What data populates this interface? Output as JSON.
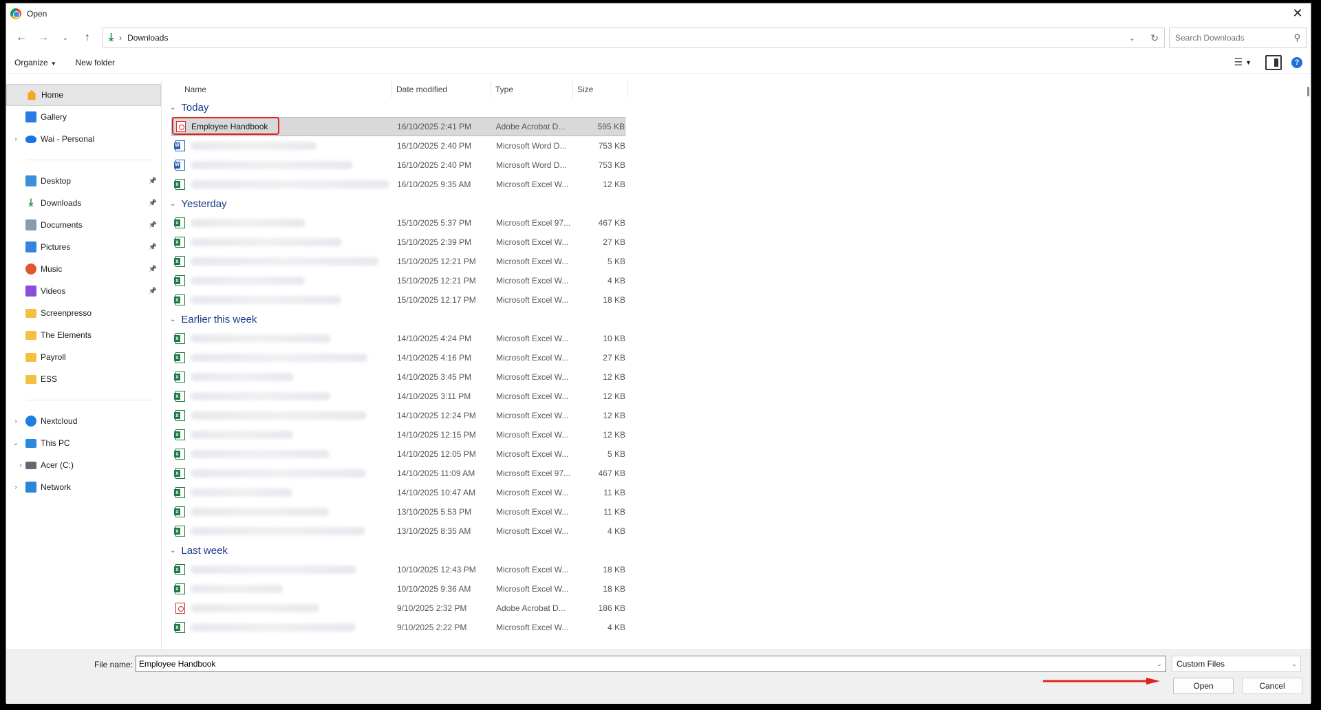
{
  "window": {
    "title": "Open"
  },
  "address": {
    "crumb": "Downloads"
  },
  "search": {
    "placeholder": "Search Downloads"
  },
  "toolbar": {
    "organize": "Organize",
    "new_folder": "New folder"
  },
  "sidebar": {
    "group1": [
      {
        "label": "Home",
        "icon": "home-icon",
        "selected": true,
        "chevron": false
      },
      {
        "label": "Gallery",
        "icon": "gallery-icon",
        "chevron": false
      },
      {
        "label": "Wai - Personal",
        "icon": "onedrive-icon",
        "chevron": true
      }
    ],
    "group2": [
      {
        "label": "Desktop",
        "icon": "desktop-icon",
        "pinned": true
      },
      {
        "label": "Downloads",
        "icon": "downloads-icon",
        "pinned": true
      },
      {
        "label": "Documents",
        "icon": "documents-icon",
        "pinned": true
      },
      {
        "label": "Pictures",
        "icon": "pictures-icon",
        "pinned": true
      },
      {
        "label": "Music",
        "icon": "music-icon",
        "pinned": true
      },
      {
        "label": "Videos",
        "icon": "videos-icon",
        "pinned": true
      },
      {
        "label": "Screenpresso",
        "icon": "folder-icon"
      },
      {
        "label": "The Elements",
        "icon": "folder-icon"
      },
      {
        "label": "Payroll",
        "icon": "folder-icon"
      },
      {
        "label": "ESS",
        "icon": "folder-icon"
      }
    ],
    "group3": [
      {
        "label": "Nextcloud",
        "icon": "nextcloud-icon",
        "chevron": "right"
      },
      {
        "label": "This PC",
        "icon": "pc-icon",
        "chevron": "down"
      },
      {
        "label": "Acer (C:)",
        "icon": "drive-icon",
        "chevron": "right",
        "indent": true
      },
      {
        "label": "Network",
        "icon": "network-icon",
        "chevron": "right"
      }
    ]
  },
  "columns": {
    "name": "Name",
    "date": "Date modified",
    "type": "Type",
    "size": "Size"
  },
  "groups": [
    {
      "label": "Today",
      "rows": [
        {
          "name": "Employee Handbook",
          "date": "16/10/2025 2:41 PM",
          "type": "Adobe Acrobat D...",
          "size": "595 KB",
          "kind": "pdf",
          "selected": true
        },
        {
          "name": "",
          "date": "16/10/2025 2:40 PM",
          "type": "Microsoft Word D...",
          "size": "753 KB",
          "kind": "wd"
        },
        {
          "name": "",
          "date": "16/10/2025 2:40 PM",
          "type": "Microsoft Word D...",
          "size": "753 KB",
          "kind": "wd"
        },
        {
          "name": "",
          "date": "16/10/2025 9:35 AM",
          "type": "Microsoft Excel W...",
          "size": "12 KB",
          "kind": "xl"
        }
      ]
    },
    {
      "label": "Yesterday",
      "rows": [
        {
          "name": "",
          "date": "15/10/2025 5:37 PM",
          "type": "Microsoft Excel 97...",
          "size": "467 KB",
          "kind": "xl"
        },
        {
          "name": "",
          "date": "15/10/2025 2:39 PM",
          "type": "Microsoft Excel W...",
          "size": "27 KB",
          "kind": "xl"
        },
        {
          "name": "",
          "date": "15/10/2025 12:21 PM",
          "type": "Microsoft Excel W...",
          "size": "5 KB",
          "kind": "xl"
        },
        {
          "name": "",
          "date": "15/10/2025 12:21 PM",
          "type": "Microsoft Excel W...",
          "size": "4 KB",
          "kind": "xl"
        },
        {
          "name": "",
          "date": "15/10/2025 12:17 PM",
          "type": "Microsoft Excel W...",
          "size": "18 KB",
          "kind": "xl"
        }
      ]
    },
    {
      "label": "Earlier this week",
      "rows": [
        {
          "name": "",
          "date": "14/10/2025 4:24 PM",
          "type": "Microsoft Excel W...",
          "size": "10 KB",
          "kind": "xl"
        },
        {
          "name": "",
          "date": "14/10/2025 4:16 PM",
          "type": "Microsoft Excel W...",
          "size": "27 KB",
          "kind": "xl"
        },
        {
          "name": "",
          "date": "14/10/2025 3:45 PM",
          "type": "Microsoft Excel W...",
          "size": "12 KB",
          "kind": "xl"
        },
        {
          "name": "",
          "date": "14/10/2025 3:11 PM",
          "type": "Microsoft Excel W...",
          "size": "12 KB",
          "kind": "xl"
        },
        {
          "name": "",
          "date": "14/10/2025 12:24 PM",
          "type": "Microsoft Excel W...",
          "size": "12 KB",
          "kind": "xl"
        },
        {
          "name": "",
          "date": "14/10/2025 12:15 PM",
          "type": "Microsoft Excel W...",
          "size": "12 KB",
          "kind": "xl"
        },
        {
          "name": "",
          "date": "14/10/2025 12:05 PM",
          "type": "Microsoft Excel W...",
          "size": "5 KB",
          "kind": "xl"
        },
        {
          "name": "",
          "date": "14/10/2025 11:09 AM",
          "type": "Microsoft Excel 97...",
          "size": "467 KB",
          "kind": "xl"
        },
        {
          "name": "",
          "date": "14/10/2025 10:47 AM",
          "type": "Microsoft Excel W...",
          "size": "11 KB",
          "kind": "xl"
        },
        {
          "name": "",
          "date": "13/10/2025 5:53 PM",
          "type": "Microsoft Excel W...",
          "size": "11 KB",
          "kind": "xl"
        },
        {
          "name": "",
          "date": "13/10/2025 8:35 AM",
          "type": "Microsoft Excel W...",
          "size": "4 KB",
          "kind": "xl"
        }
      ]
    },
    {
      "label": "Last week",
      "rows": [
        {
          "name": "",
          "date": "10/10/2025 12:43 PM",
          "type": "Microsoft Excel W...",
          "size": "18 KB",
          "kind": "xl"
        },
        {
          "name": "",
          "date": "10/10/2025 9:36 AM",
          "type": "Microsoft Excel W...",
          "size": "18 KB",
          "kind": "xl"
        },
        {
          "name": "",
          "date": "9/10/2025 2:32 PM",
          "type": "Adobe Acrobat D...",
          "size": "186 KB",
          "kind": "pdf"
        },
        {
          "name": "",
          "date": "9/10/2025 2:22 PM",
          "type": "Microsoft Excel W...",
          "size": "4 KB",
          "kind": "xl"
        }
      ]
    }
  ],
  "footer": {
    "file_name_label": "File name:",
    "file_name_value": "Employee Handbook",
    "filter_value": "Custom Files",
    "open_label": "Open",
    "cancel_label": "Cancel"
  },
  "colors": {
    "highlight": "#d9251d",
    "group_heading": "#1b3a8a",
    "selection": "#d9d9d9"
  }
}
